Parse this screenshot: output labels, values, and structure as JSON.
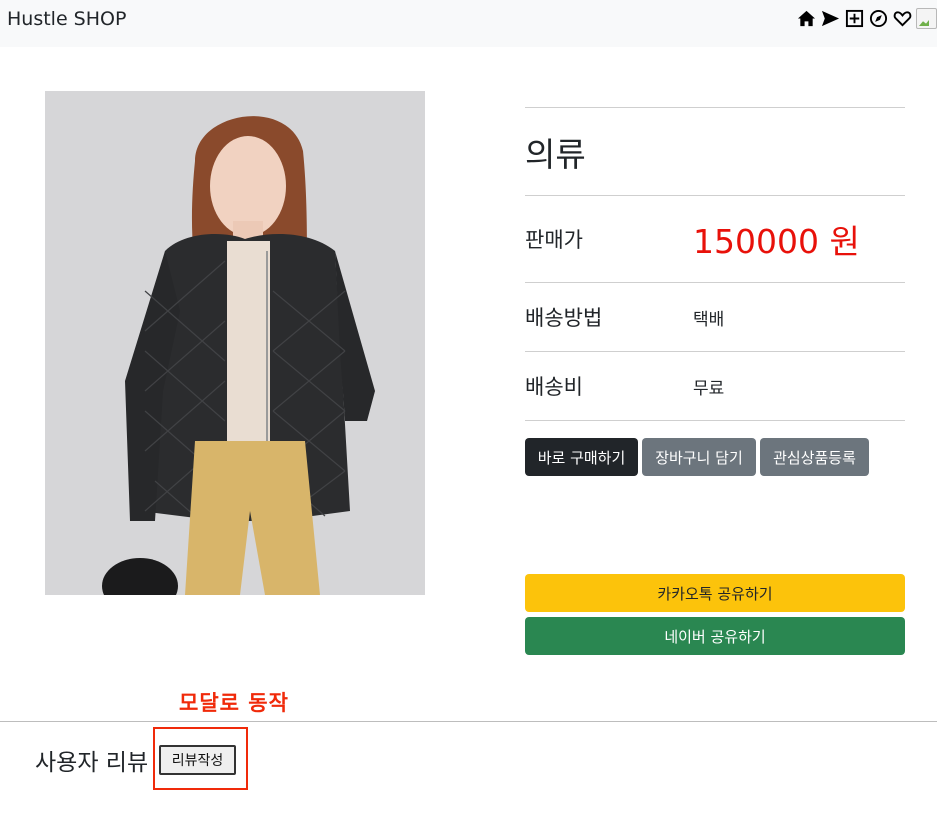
{
  "navbar": {
    "brand": "Hustle SHOP",
    "icons": [
      "home-icon",
      "send-icon",
      "plus-square-icon",
      "compass-icon",
      "heart-icon",
      "broken-image-icon"
    ]
  },
  "product": {
    "image_alt": "product photo",
    "category": "의류",
    "price_label": "판매가",
    "price_value": "150000 원",
    "shipping_label": "배송방법",
    "shipping_value": "택배",
    "fee_label": "배송비",
    "fee_value": "무료"
  },
  "actions": {
    "buy": "바로 구매하기",
    "cart": "장바구니 담기",
    "wishlist": "관심상품등록"
  },
  "share": {
    "kakao": "카카오톡 공유하기",
    "naver": "네이버 공유하기"
  },
  "review": {
    "title": "사용자 리뷰",
    "write_button": "리뷰작성",
    "annotation": "모달로 동작"
  },
  "colors": {
    "price": "#e8110a",
    "annotation": "#f02a0a",
    "kakao": "#fcc30b",
    "naver": "#2a8751",
    "dark_button": "#212529",
    "gray_button": "#6c757d"
  }
}
